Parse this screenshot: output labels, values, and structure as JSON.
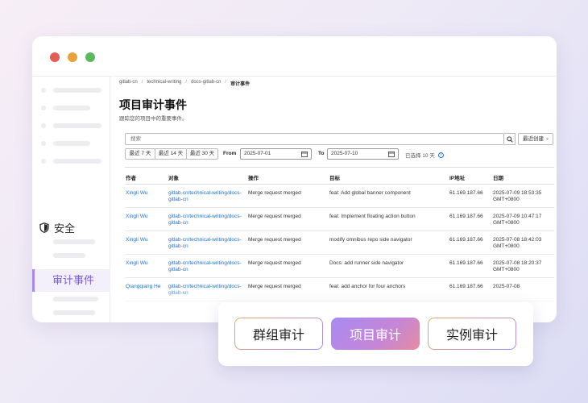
{
  "window": {
    "controls": [
      "close",
      "minimize",
      "maximize"
    ]
  },
  "sidebar": {
    "security_label": "安全",
    "security_icon": "shield-icon",
    "active_item_label": "审计事件",
    "accent_color": "#a68af0"
  },
  "breadcrumb": [
    "gitlab-cn",
    "technical-writing",
    "docs-gitlab-cn",
    "审计事件"
  ],
  "page": {
    "title": "项目审计事件",
    "subtitle": "跟踪您的项目中的重要事件。"
  },
  "filters": {
    "search_placeholder": "搜索",
    "sort_label": "最近创建",
    "quick_ranges": [
      "最近 7 天",
      "最近 14 天",
      "最近 30 天"
    ],
    "from_label": "From",
    "from_value": "2025-07-01",
    "to_label": "To",
    "to_value": "2025-07-10",
    "selected_days": "已选择 10 天"
  },
  "table": {
    "headers": [
      "作者",
      "对象",
      "操作",
      "目标",
      "IP地址",
      "日期"
    ],
    "rows": [
      {
        "author": "Xingli Wu",
        "target": "gitlab-cn/technical-writing/docs-gitlab-cn",
        "action": "Merge request merged",
        "goal": "feat: Add global banner component",
        "ip": "61.169.187.66",
        "date": "2025-07-09 18:53:35 GMT+0800"
      },
      {
        "author": "Xingli Wu",
        "target": "gitlab-cn/technical-writing/docs-gitlab-cn",
        "action": "Merge request merged",
        "goal": "feat: Implement floating action button",
        "ip": "61.169.187.66",
        "date": "2025-07-09 10:47:17 GMT+0800"
      },
      {
        "author": "Xingli Wu",
        "target": "gitlab-cn/technical-writing/docs-gitlab-cn",
        "action": "Merge request merged",
        "goal": "modify omnibus repo side navigator",
        "ip": "61.169.187.66",
        "date": "2025-07-08 18:42:03 GMT+0800"
      },
      {
        "author": "Xingli Wu",
        "target": "gitlab-cn/technical-writing/docs-gitlab-cn",
        "action": "Merge request merged",
        "goal": "Docs: add runner side navigator",
        "ip": "61.169.187.66",
        "date": "2025-07-08 18:20:37 GMT+0800"
      },
      {
        "author": "Qiangqiang He",
        "target": "gitlab-cn/technical-writing/docs-gitlab-cn",
        "action": "Merge request merged",
        "goal": "feat: add anchor for four anchors",
        "ip": "61.169.187.66",
        "date": "2025-07-08"
      }
    ]
  },
  "audit_tabs": [
    "群组审计",
    "项目审计",
    "实例审计"
  ],
  "active_tab_index": 1
}
